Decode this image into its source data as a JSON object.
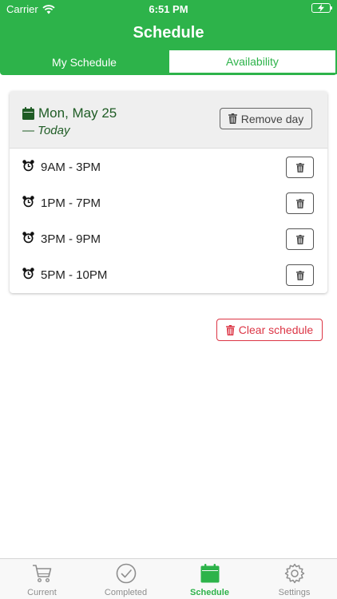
{
  "status_bar": {
    "carrier": "Carrier",
    "time": "6:51 PM"
  },
  "nav": {
    "title": "Schedule"
  },
  "segments": {
    "left_label": "My Schedule",
    "right_label": "Availability"
  },
  "day_card": {
    "date": "Mon, May 25",
    "subtitle": "— Today",
    "remove_label": "Remove day",
    "shifts": [
      {
        "label": "9AM - 3PM"
      },
      {
        "label": "1PM - 7PM"
      },
      {
        "label": "3PM - 9PM"
      },
      {
        "label": "5PM - 10PM"
      }
    ]
  },
  "clear_label": "Clear schedule",
  "tabs": [
    {
      "label": "Current",
      "icon": "cart-icon"
    },
    {
      "label": "Completed",
      "icon": "check-circle-icon"
    },
    {
      "label": "Schedule",
      "icon": "calendar-icon",
      "active": true
    },
    {
      "label": "Settings",
      "icon": "gear-icon"
    }
  ],
  "colors": {
    "brand_green": "#2db34a",
    "dark_green": "#1f5c25",
    "danger": "#dc3545"
  }
}
